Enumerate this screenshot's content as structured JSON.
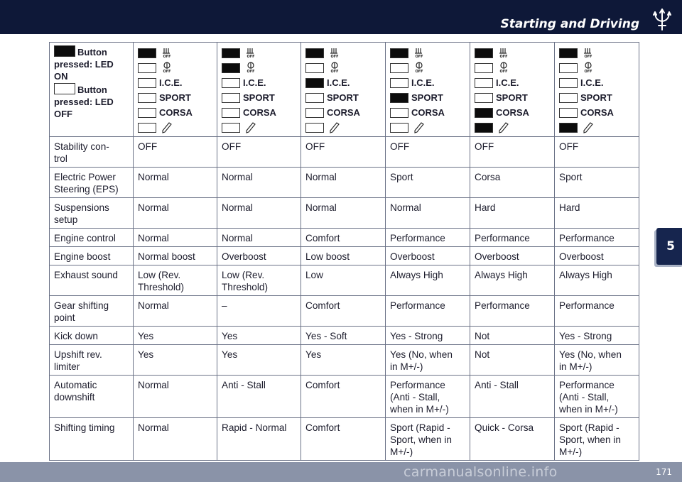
{
  "header": {
    "title": "Starting and Driving",
    "logo": "trident-icon"
  },
  "chapter_tab": {
    "label": "5"
  },
  "footer": {
    "page_number": "171",
    "watermark": "carmanualsonline.info"
  },
  "legend": {
    "on_text": "Button pressed: LED ON",
    "off_text": "Button pressed: LED OFF"
  },
  "mode_labels": {
    "ice": "I.C.E.",
    "sport": "SPORT",
    "corsa": "CORSA"
  },
  "icon_names": {
    "row1": "stability-off-icon",
    "row2": "eps-off-icon",
    "row6": "pen-icon"
  },
  "columns": [
    {
      "leds": [
        true,
        false,
        false,
        false,
        false,
        false
      ]
    },
    {
      "leds": [
        true,
        true,
        false,
        false,
        false,
        false
      ]
    },
    {
      "leds": [
        true,
        false,
        true,
        false,
        false,
        false
      ]
    },
    {
      "leds": [
        true,
        false,
        false,
        true,
        false,
        false
      ]
    },
    {
      "leds": [
        true,
        false,
        false,
        false,
        true,
        true
      ]
    },
    {
      "leds": [
        true,
        false,
        false,
        false,
        false,
        true
      ]
    }
  ],
  "rows": [
    {
      "label": "Stability con-\ntrol",
      "values": [
        "OFF",
        "OFF",
        "OFF",
        "OFF",
        "OFF",
        "OFF"
      ]
    },
    {
      "label": "Electric Power\nSteering (EPS)",
      "values": [
        "Normal",
        "Normal",
        "Normal",
        "Sport",
        "Corsa",
        "Sport"
      ]
    },
    {
      "label": "Suspensions\nsetup",
      "values": [
        "Normal",
        "Normal",
        "Normal",
        "Normal",
        "Hard",
        "Hard"
      ]
    },
    {
      "label": "Engine control",
      "values": [
        "Normal",
        "Normal",
        "Comfort",
        "Performance",
        "Performance",
        "Performance"
      ]
    },
    {
      "label": "Engine boost",
      "values": [
        "Normal boost",
        "Overboost",
        "Low boost",
        "Overboost",
        "Overboost",
        "Overboost"
      ]
    },
    {
      "label": "Exhaust sound",
      "values": [
        "Low (Rev.\nThreshold)",
        "Low (Rev.\nThreshold)",
        "Low",
        "Always High",
        "Always High",
        "Always High"
      ]
    },
    {
      "label": "Gear shifting\npoint",
      "values": [
        "Normal",
        "–",
        "Comfort",
        "Performance",
        "Performance",
        "Performance"
      ]
    },
    {
      "label": "Kick down",
      "values": [
        "Yes",
        "Yes",
        "Yes - Soft",
        "Yes - Strong",
        "Not",
        "Yes - Strong"
      ]
    },
    {
      "label": "Upshift rev.\nlimiter",
      "values": [
        "Yes",
        "Yes",
        "Yes",
        "Yes (No, when\nin M+/-)",
        "Not",
        "Yes (No, when\nin M+/-)"
      ]
    },
    {
      "label": "Automatic\ndownshift",
      "values": [
        "Normal",
        "Anti - Stall",
        "Comfort",
        "Performance\n(Anti - Stall,\nwhen in M+/-)",
        "Anti - Stall",
        "Performance\n(Anti - Stall,\nwhen in M+/-)"
      ]
    },
    {
      "label": "Shifting timing",
      "values": [
        "Normal",
        "Rapid - Normal",
        "Comfort",
        "Sport (Rapid -\nSport, when in\nM+/-)",
        "Quick - Corsa",
        "Sport (Rapid -\nSport, when in\nM+/-)"
      ]
    }
  ],
  "colors": {
    "header_bg": "#0e1838",
    "footer_bg": "#8a93a8",
    "tab_bg": "#16254e",
    "led_on": "#0c0c0c"
  }
}
